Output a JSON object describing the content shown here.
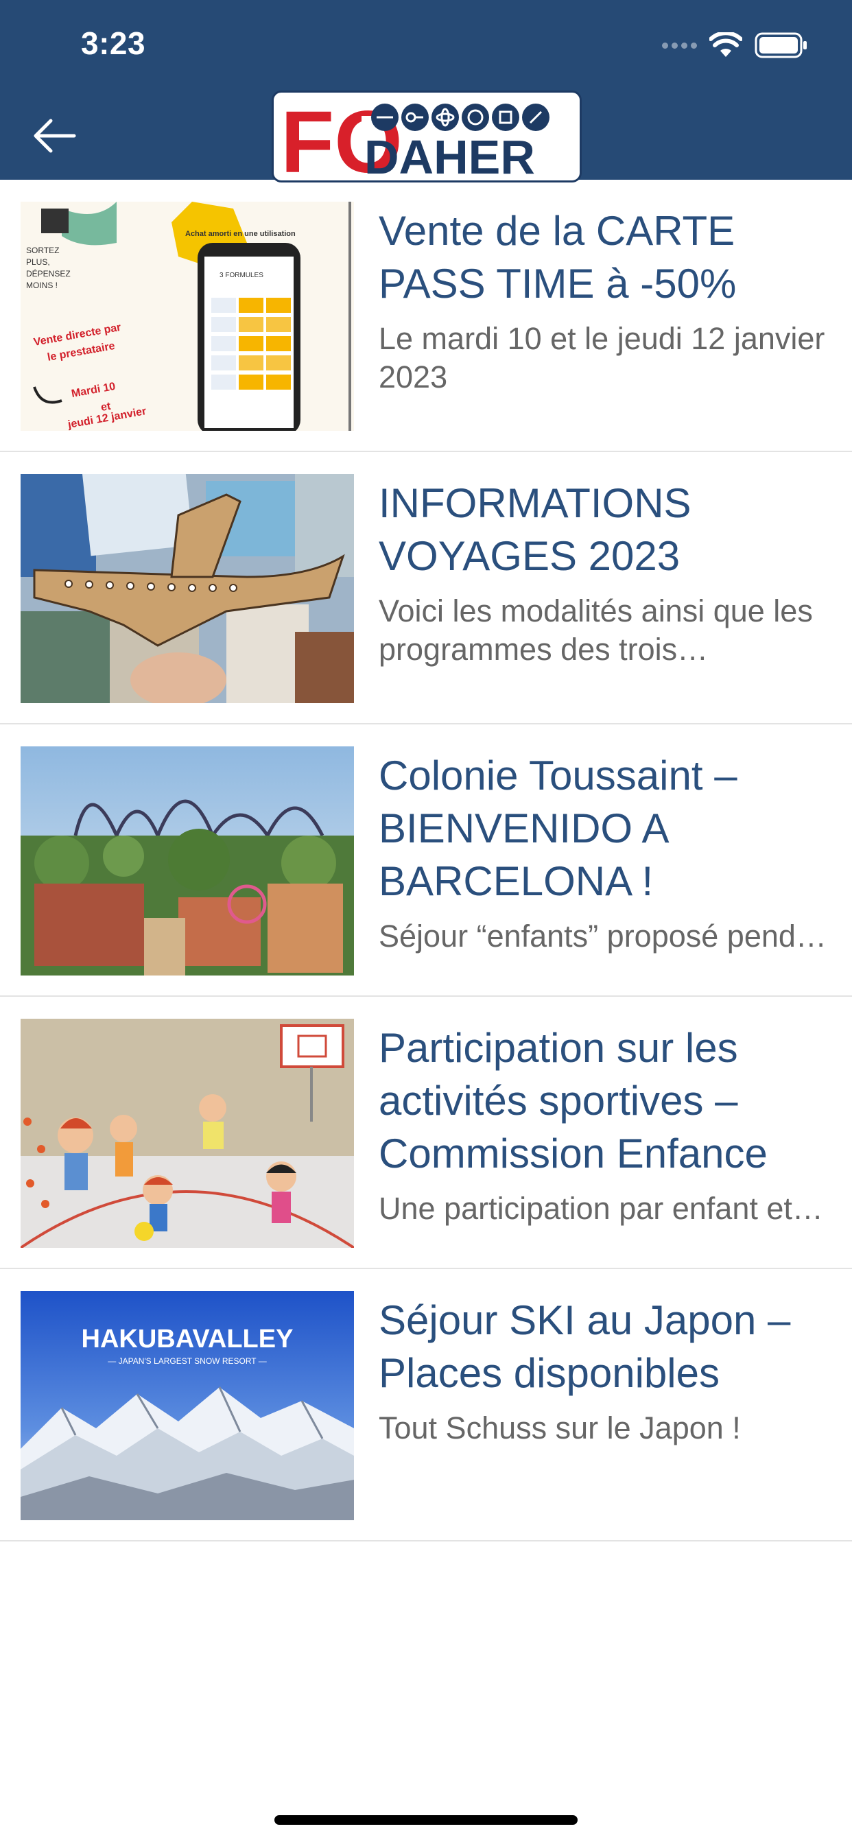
{
  "status_bar": {
    "time": "3:23"
  },
  "header": {
    "logo_text_left": "FO",
    "logo_text_right": "DAHER"
  },
  "colors": {
    "header_bg": "#264a75",
    "title": "#2a4f7d",
    "subtitle": "#666666"
  },
  "articles": [
    {
      "title": "Vente de la CARTE PASS TIME à -50%",
      "subtitle": "Le mardi 10 et le jeudi 12 janvier 2023",
      "image": {
        "badge": "Achat amorti en une utilisation",
        "text1": "SORTEZ",
        "text2": "PLUS,",
        "text3": "DÉPENSEZ",
        "text4": "MOINS !",
        "red1": "Vente directe par",
        "red2": "le prestataire",
        "red3": "Mardi 10",
        "red4": "et",
        "red5": "jeudi 12 janvier",
        "phone_header": "3 FORMULES"
      }
    },
    {
      "title": "INFORMATIONS VOYAGES 2023",
      "subtitle": "Voici les modalités ainsi que les programmes des trois destinations"
    },
    {
      "title": "Colonie Toussaint – BIENVENIDO A BARCELONA !",
      "subtitle": "Séjour “enfants” proposé pendant les vacances"
    },
    {
      "title": "Participation sur les activités sportives – Commission Enfance",
      "subtitle": "Une participation par enfant et par an"
    },
    {
      "title": "Séjour SKI au Japon – Places disponibles",
      "subtitle": "Tout Schuss sur le Japon !",
      "image": {
        "brand": "HAKUBAVALLEY",
        "tagline": "— JAPAN'S LARGEST SNOW RESORT —"
      }
    }
  ]
}
